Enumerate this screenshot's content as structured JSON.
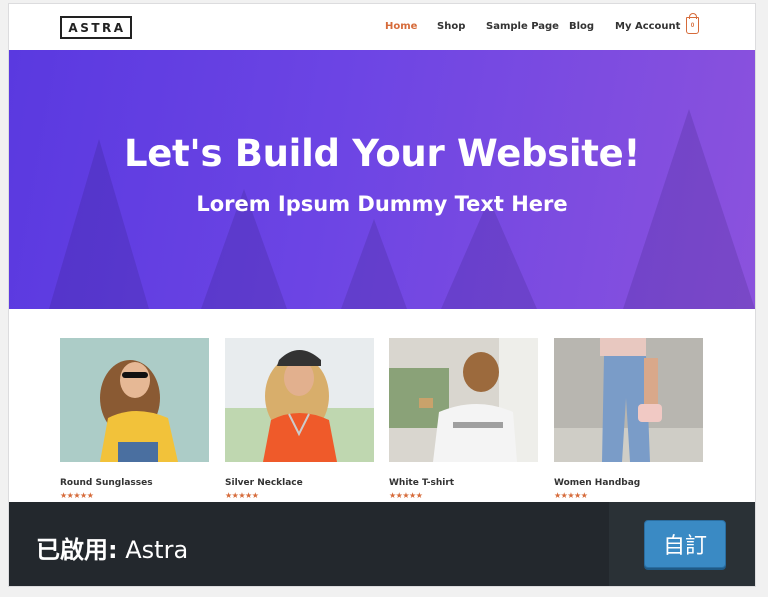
{
  "site": {
    "logo_text": "ASTRA",
    "nav": [
      {
        "label": "Home",
        "active": true
      },
      {
        "label": "Shop",
        "active": false
      },
      {
        "label": "Sample Page",
        "active": false
      },
      {
        "label": "Blog",
        "active": false
      },
      {
        "label": "My Account",
        "active": false
      }
    ],
    "cart_count": "0",
    "accent_color": "#d66b3a"
  },
  "hero": {
    "title": "Let's Build Your Website!",
    "subtitle": "Lorem Ipsum Dummy Text Here"
  },
  "products": [
    {
      "name": "Round Sunglasses",
      "stars": "★★★★★"
    },
    {
      "name": "Silver Necklace",
      "stars": "★★★★★"
    },
    {
      "name": "White T-shirt",
      "stars": "★★★★★"
    },
    {
      "name": "Women Handbag",
      "stars": "★★★★★"
    }
  ],
  "theme_bar": {
    "active_prefix": "已啟用:",
    "theme_name": "Astra",
    "customize_label": "自訂"
  }
}
